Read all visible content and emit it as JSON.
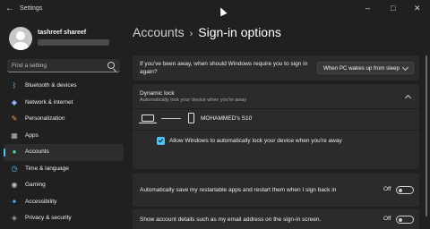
{
  "window": {
    "title": "Settings",
    "controls": [
      "–",
      "□",
      "✕"
    ]
  },
  "user": {
    "name": "tashreef shareef"
  },
  "search": {
    "placeholder": "Find a setting"
  },
  "nav": [
    {
      "label": "Bluetooth & devices",
      "icon": "bluetooth-icon",
      "glyph": "ᛒ",
      "color": "#4cc2ff"
    },
    {
      "label": "Network & internet",
      "icon": "wifi-icon",
      "glyph": "◆",
      "color": "#8ab4f8"
    },
    {
      "label": "Personalization",
      "icon": "brush-icon",
      "glyph": "✎",
      "color": "#f4a259"
    },
    {
      "label": "Apps",
      "icon": "apps-icon",
      "glyph": "▦",
      "color": "#bcbcbc"
    },
    {
      "label": "Accounts",
      "icon": "person-icon",
      "glyph": "●",
      "color": "#5fd6a0",
      "active": true
    },
    {
      "label": "Time & language",
      "icon": "clock-globe-icon",
      "glyph": "◷",
      "color": "#4cc2ff"
    },
    {
      "label": "Gaming",
      "icon": "controller-icon",
      "glyph": "◉",
      "color": "#bcbcbc"
    },
    {
      "label": "Accessibility",
      "icon": "accessibility-icon",
      "glyph": "✦",
      "color": "#4cc2ff"
    },
    {
      "label": "Privacy & security",
      "icon": "shield-icon",
      "glyph": "◈",
      "color": "#9a9a9a"
    }
  ],
  "breadcrumb": {
    "parent": "Accounts",
    "separator": "›",
    "current": "Sign-in options"
  },
  "require_signin": {
    "question": "If you've been away, when should Windows require you to sign in again?",
    "selected": "When PC wakes up from sleep"
  },
  "dynamic_lock": {
    "title": "Dynamic lock",
    "subtitle": "Automatically lock your device when you're away",
    "device_name": "MOHAMMED's S10",
    "checkbox_label": "Allow Windows to automatically lock your device when you're away",
    "checked": true
  },
  "restart_apps": {
    "label": "Automatically save my restartable apps and restart them when I sign back in",
    "state": "Off"
  },
  "account_details": {
    "label": "Show account details such as my email address on the sign-in screen.",
    "state": "Off"
  },
  "colors": {
    "accent": "#4cc2ff",
    "background": "#202020",
    "card": "#2b2b2b"
  }
}
